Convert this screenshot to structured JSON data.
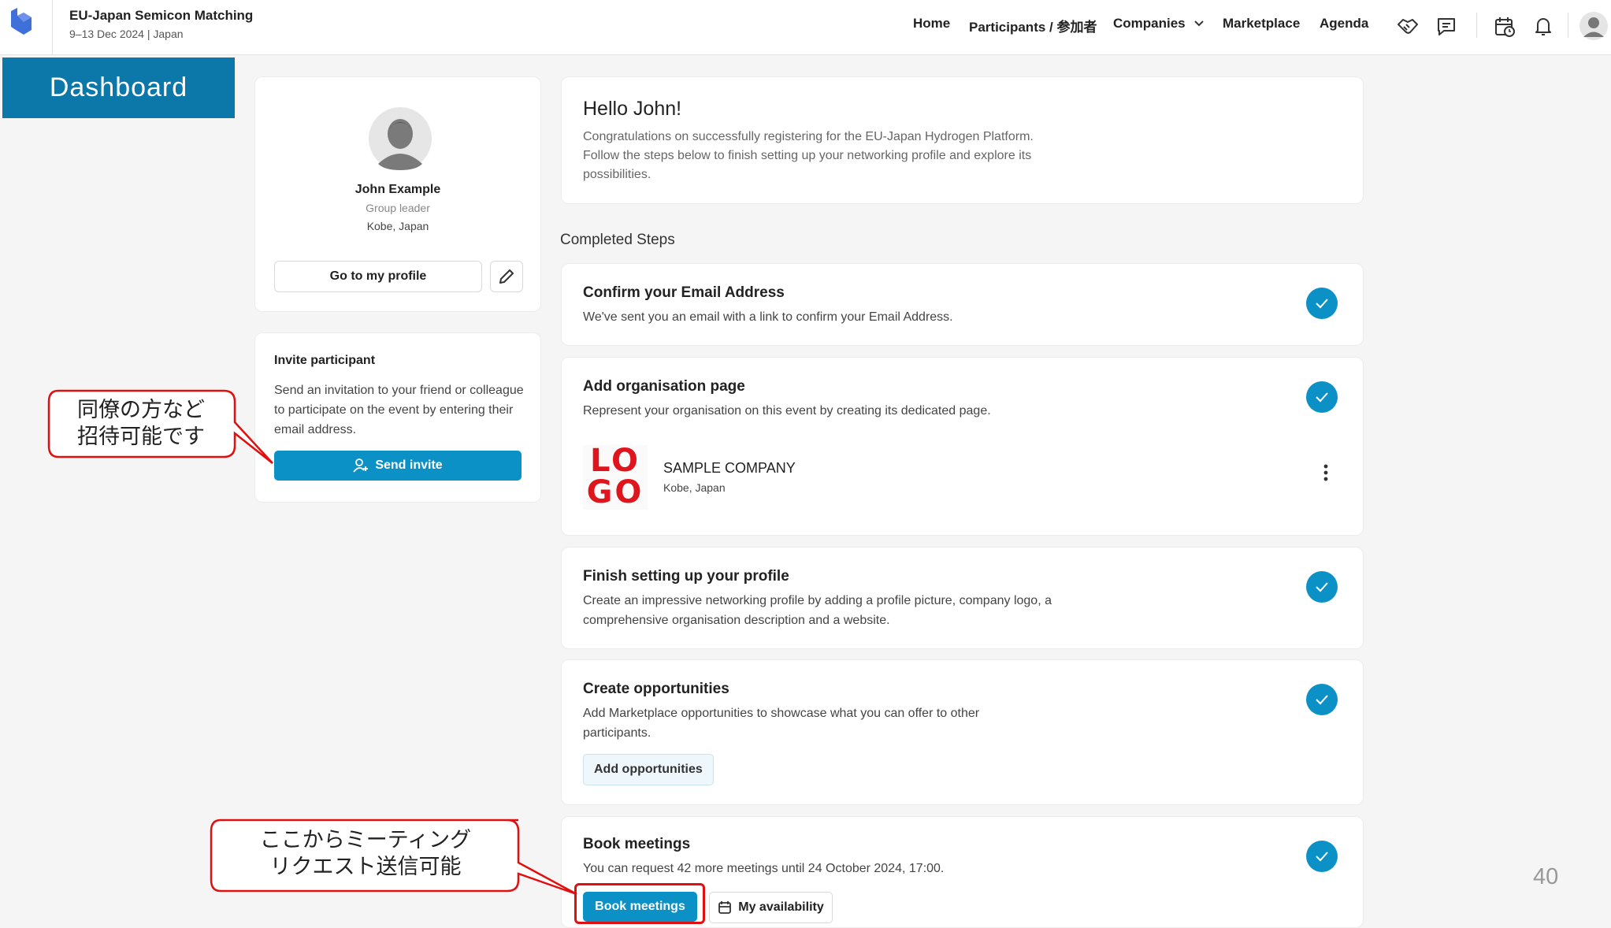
{
  "header": {
    "event_title": "EU-Japan Semicon Matching",
    "event_subtitle": "9–13 Dec 2024 | Japan",
    "nav": [
      "Home",
      "Participants / 参加者",
      "Companies",
      "Marketplace",
      "Agenda"
    ],
    "icons": [
      "handshake-icon",
      "chat-icon",
      "calendar-clock-icon",
      "bell-icon",
      "user-avatar"
    ]
  },
  "dashboard_label": "Dashboard",
  "profile": {
    "name": "John Example",
    "role": "Group leader",
    "location": "Kobe, Japan",
    "go_profile": "Go to my profile"
  },
  "invite": {
    "title": "Invite participant",
    "text": "Send an invitation to your friend or colleague to participate on the event by entering their email address.",
    "button": "Send invite"
  },
  "hello": {
    "title": "Hello John!",
    "text": "Congratulations on successfully registering for the EU-Japan Hydrogen Platform. Follow the steps below to finish setting up your networking profile and explore its possibilities."
  },
  "completed_title": "Completed Steps",
  "steps": [
    {
      "title": "Confirm your Email Address",
      "text": "We've sent you an email with a link to confirm your Email Address."
    },
    {
      "title": "Add organisation page",
      "text": "Represent your organisation on this event by creating its dedicated page."
    },
    {
      "title": "Finish setting up your profile",
      "text": "Create an impressive networking profile by adding a profile picture, company logo, a comprehensive organisation description and a website."
    },
    {
      "title": "Create opportunities",
      "text": "Add Marketplace opportunities to showcase what you can offer to other participants."
    },
    {
      "title": "Book meetings",
      "text": "You can request 42 more meetings until 24 October 2024, 17:00."
    }
  ],
  "company": {
    "logo_line1": "LO",
    "logo_line2": "GO",
    "name": "SAMPLE COMPANY",
    "location": "Kobe, Japan"
  },
  "buttons": {
    "add_opportunities": "Add opportunities",
    "book_meetings": "Book meetings",
    "my_availability": "My availability"
  },
  "annotations": {
    "invite_note_line1": "同僚の方など",
    "invite_note_line2": "招待可能です",
    "book_note_line1": "ここからミーティング",
    "book_note_line2": "リクエスト送信可能"
  },
  "page_number": "40",
  "colors": {
    "accent": "#0c91c7",
    "dashboard_bg": "#0b78a9",
    "callout_border": "#e01010"
  }
}
